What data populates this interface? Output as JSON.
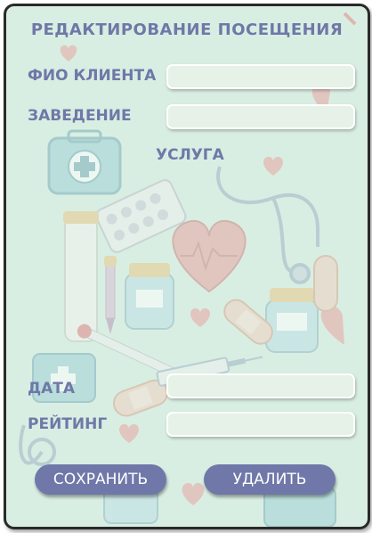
{
  "form": {
    "title": "РЕДАКТИРОВАНИЕ ПОСЕЩЕНИЯ",
    "client_label": "ФИО КЛИЕНТА",
    "client_value": "",
    "establishment_label": "ЗАВЕДЕНИЕ",
    "establishment_value": "",
    "service_label": "УСЛУГА",
    "date_label": "ДАТА",
    "date_value": "",
    "rating_label": "РЕЙТИНГ",
    "rating_value": ""
  },
  "actions": {
    "save_label": "СОХРАНИТЬ",
    "delete_label": "УДАЛИТЬ"
  },
  "colors": {
    "accent": "#6f78a8",
    "background": "#d9eee2",
    "field": "#e6f1e8"
  },
  "background_icons": [
    "first-aid-kit-icon",
    "pill-blister-icon",
    "heart-icon",
    "stethoscope-icon",
    "syringe-icon",
    "medicine-bottle-icon",
    "thermometer-icon",
    "bandage-icon",
    "dropper-icon",
    "test-tube-icon"
  ]
}
